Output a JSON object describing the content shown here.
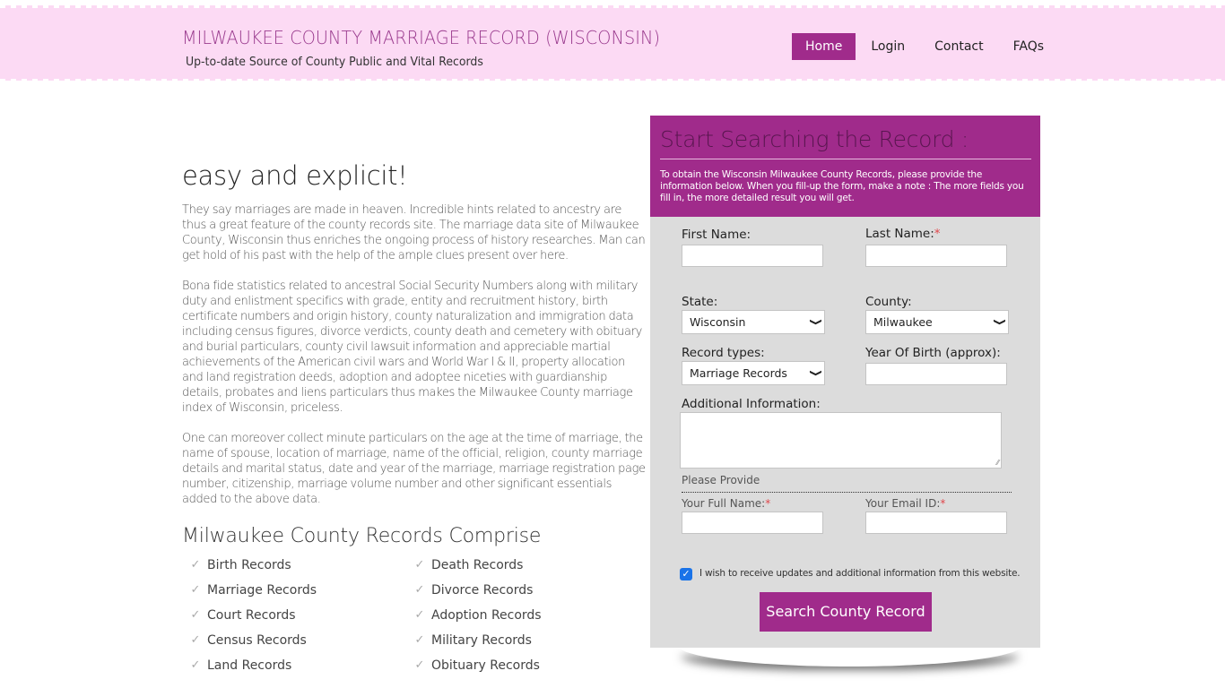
{
  "header": {
    "site_title": "MILWAUKEE COUNTY MARRIAGE RECORD (WISCONSIN)",
    "tagline": "Up-to-date Source of  County Public and Vital Records",
    "nav": [
      {
        "label": "Home",
        "active": true
      },
      {
        "label": "Login",
        "active": false
      },
      {
        "label": "Contact",
        "active": false
      },
      {
        "label": "FAQs",
        "active": false
      }
    ]
  },
  "main": {
    "hero_title": "easy and explicit!",
    "paragraphs": [
      "They say marriages are made in heaven. Incredible hints related to ancestry are thus a great feature of the county records site. The marriage data site of Milwaukee County, Wisconsin thus enriches the ongoing process of history researches. Man can get hold of his past with the help of the ample clues present over here.",
      "Bona fide statistics related to ancestral Social Security Numbers along with military duty and enlistment specifics with grade, entity and recruitment history, birth certificate numbers and origin history, county naturalization and immigration data including census figures, divorce verdicts, county death and cemetery with obituary and burial particulars, county civil lawsuit information and appreciable martial achievements of the American civil wars and World War I & II, property allocation and land registration deeds, adoption and adoptee niceties with guardianship details, probates and liens particulars thus makes the Milwaukee County marriage index of Wisconsin, priceless.",
      "One can moreover collect minute particulars on the age at the time of marriage, the name of spouse, location of marriage, name of the official, religion, county marriage details and marital status, date and year of the marriage, marriage registration page number, citizenship, marriage volume number and other significant essentials added to the above data."
    ],
    "records_title": "Milwaukee County Records Comprise",
    "records": [
      "Birth Records",
      "Death Records",
      "Marriage Records",
      "Divorce Records",
      "Court Records",
      "Adoption Records",
      "Census Records",
      "Military Records",
      "Land Records",
      "Obituary Records"
    ]
  },
  "form": {
    "title": "Start Searching the Record :",
    "description": "To obtain the Wisconsin Milwaukee County Records, please provide the information below. When you fill-up the form, make a note : The more fields you fill in, the more detailed result you will get.",
    "first_name_label": "First Name:",
    "first_name_value": "",
    "last_name_label": "Last Name:",
    "last_name_value": "",
    "required_mark": "*",
    "state_label": "State:",
    "state_value": "Wisconsin",
    "county_label": "County:",
    "county_value": "Milwaukee",
    "record_types_label": "Record types:",
    "record_types_value": "Marriage Records",
    "year_of_birth_label": "Year Of Birth (approx):",
    "year_of_birth_value": "",
    "additional_info_label": "Additional Information:",
    "additional_info_value": "",
    "please_provide": "Please Provide",
    "full_name_label": "Your Full Name:",
    "full_name_value": "",
    "email_label": "Your Email ID:",
    "email_value": "",
    "updates_checked": true,
    "updates_label": "I wish to receive updates and additional information from this website.",
    "submit_label": "Search County Record"
  },
  "colors": {
    "accent": "#a02b8b",
    "header_bg": "#fcdaf4",
    "panel_bg": "#dcdcdc",
    "required": "#e0474c"
  }
}
